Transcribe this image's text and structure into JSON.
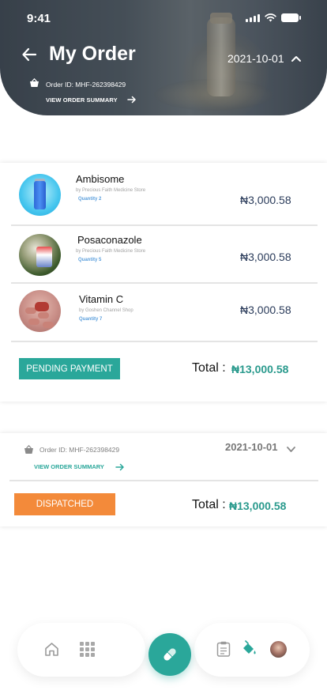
{
  "status_bar": {
    "time": "9:41"
  },
  "header": {
    "title": "My Order",
    "date": "2021-10-01",
    "order_id": "Order ID: MHF-262398429",
    "summary_label": "VIEW ORDER SUMMARY"
  },
  "order1": {
    "items": [
      {
        "name": "Ambisome",
        "store": "by Precious Faith Medicine Store",
        "quantity": "Quantity 2",
        "price": "₦3,000.58"
      },
      {
        "name": "Posaconazole",
        "store": "by Precious Faith Medicine Store",
        "quantity": "Quantity 5",
        "price": "₦3,000.58"
      },
      {
        "name": "Vitamin C",
        "store": "by Goshen Channel Shop",
        "quantity": "Quantity 7",
        "price": "₦3,000.58"
      }
    ],
    "status": "PENDING PAYMENT",
    "total_label": "Total :",
    "total_value": "₦13,000.58"
  },
  "order2": {
    "order_id": "Order ID: MHF-262398429",
    "date": "2021-10-01",
    "summary_label": "VIEW ORDER SUMMARY",
    "status": "DISPATCHED",
    "total_label": "Total :",
    "total_value": "₦13,000.58"
  },
  "colors": {
    "accent_teal": "#2aa79a",
    "pending_badge": "#2aa79a",
    "dispatched_badge": "#f38a3a",
    "price_text": "#2a3b5a",
    "quantity_text": "#5b9fdc"
  },
  "icons": {
    "header": [
      "back-arrow-icon",
      "chevron-up-icon",
      "basket-icon",
      "arrow-right-icon"
    ],
    "nav": [
      "home-icon",
      "grid-icon",
      "pill-icon",
      "clipboard-icon",
      "paint-bucket-icon",
      "avatar"
    ]
  }
}
